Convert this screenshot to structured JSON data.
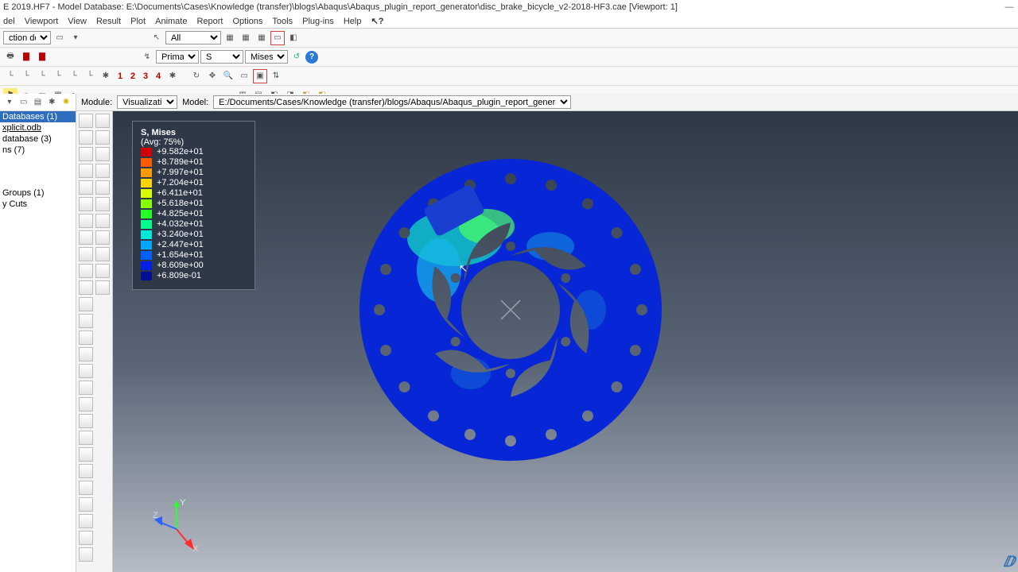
{
  "title": "E 2019.HF7 - Model Database: E:\\Documents\\Cases\\Knowledge (transfer)\\blogs\\Abaqus\\Abaqus_plugin_report_generator\\disc_brake_bicycle_v2-2018-HF3.cae  [Viewport: 1]",
  "menu": [
    "del",
    "Viewport",
    "View",
    "Result",
    "Plot",
    "Animate",
    "Report",
    "Options",
    "Tools",
    "Plug-ins",
    "Help"
  ],
  "toolbar1": {
    "defaults": "ction defaults",
    "all": "All"
  },
  "toolbar2": {
    "primary": "Primary",
    "s": "S",
    "mises": "Mises"
  },
  "frames": [
    "1",
    "2",
    "3",
    "4"
  ],
  "module": {
    "label": "Module:",
    "value": "Visualization",
    "modelLabel": "Model:",
    "modelPath": "E:/Documents/Cases/Knowledge (transfer)/blogs/Abaqus/Abaqus_plugin_report_generator/results_explicit.odb"
  },
  "tree": {
    "databases": "Databases (1)",
    "odb": "xplicit.odb",
    "database": "database (3)",
    "ns": "ns (7)",
    "groups": "Groups (1)",
    "cuts": "y Cuts"
  },
  "legend": {
    "title": "S, Mises",
    "avg": "(Avg: 75%)",
    "rows": [
      {
        "c": "#d40000",
        "v": "+9.582e+01"
      },
      {
        "c": "#ff5a00",
        "v": "+8.789e+01"
      },
      {
        "c": "#ff9a00",
        "v": "+7.997e+01"
      },
      {
        "c": "#ffd400",
        "v": "+7.204e+01"
      },
      {
        "c": "#d8ff00",
        "v": "+6.411e+01"
      },
      {
        "c": "#86ff00",
        "v": "+5.618e+01"
      },
      {
        "c": "#24ff24",
        "v": "+4.825e+01"
      },
      {
        "c": "#00ff8a",
        "v": "+4.032e+01"
      },
      {
        "c": "#00e8d8",
        "v": "+3.240e+01"
      },
      {
        "c": "#00a8ff",
        "v": "+2.447e+01"
      },
      {
        "c": "#0060ff",
        "v": "+1.654e+01"
      },
      {
        "c": "#0020e8",
        "v": "+8.609e+00"
      },
      {
        "c": "#001090",
        "v": "+6.809e-01"
      }
    ]
  },
  "triad": {
    "x": "X",
    "y": "Y",
    "z": "Z"
  }
}
